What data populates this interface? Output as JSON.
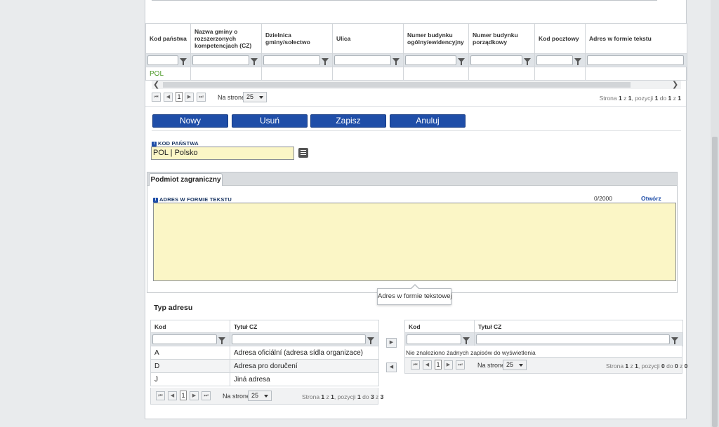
{
  "main_grid": {
    "columns": [
      "Kod państwa",
      "Nazwa gminy o rozszerzonych kompetencjach (CZ)",
      "Dzielnica gminy/sołectwo",
      "Ulica",
      "Numer budynku ogólny/ewidencyjny",
      "Numer budynku porządkowy",
      "Kod pocztowy",
      "Adres w formie tekstu"
    ],
    "rows": [
      [
        "POL",
        "",
        "",
        "",
        "",
        "",
        "",
        ""
      ]
    ],
    "pager": {
      "page": "1",
      "per_page_label": "Na stronę",
      "per_page": "25",
      "info": {
        "p1": "Strona",
        "page": "1",
        "p2": "z",
        "pages": "1",
        "p3": ", pozycji",
        "from": "1",
        "p4": "do",
        "to": "1",
        "p5": "z",
        "total": "1"
      }
    }
  },
  "actions": {
    "new": "Nowy",
    "delete": "Usuń",
    "save": "Zapisz",
    "cancel": "Anuluj"
  },
  "country_field": {
    "label": "KOD PAŃSTWA",
    "value": "POL | Polsko"
  },
  "tab": {
    "label": "Podmiot zagraniczny"
  },
  "address_text": {
    "label": "ADRES W FORMIE TEKSTU",
    "counter": "0/2000",
    "open_link": "Otwórz",
    "value": "",
    "tooltip": "Adres w formie tekstowej"
  },
  "address_type": {
    "title": "Typ adresu",
    "left_grid": {
      "columns": [
        "Kod",
        "Tytuł CZ"
      ],
      "rows": [
        [
          "A",
          "Adresa oficiální (adresa sídla organizace)"
        ],
        [
          "D",
          "Adresa pro doručení"
        ],
        [
          "J",
          "Jiná adresa"
        ]
      ],
      "pager": {
        "page": "1",
        "per_page_label": "Na stronę",
        "per_page": "25",
        "info": {
          "p1": "Strona",
          "page": "1",
          "p2": "z",
          "pages": "1",
          "p3": ", pozycji",
          "from": "1",
          "p4": "do",
          "to": "3",
          "p5": "z",
          "total": "3"
        }
      }
    },
    "right_grid": {
      "columns": [
        "Kod",
        "Tytuł CZ"
      ],
      "empty_message": "Nie znaleziono żadnych zapisów do wyświetlenia",
      "pager": {
        "page": "1",
        "per_page_label": "Na stronę",
        "per_page": "25",
        "info": {
          "p1": "Strona",
          "page": "1",
          "p2": "z",
          "pages": "1",
          "p3": ", pozycji",
          "from": "0",
          "p4": "do",
          "to": "0",
          "p5": "z",
          "total": "0"
        }
      }
    }
  },
  "colors": {
    "accent": "#1f4ea8",
    "input_highlight": "#fbf6c6",
    "link": "#1f4ea8",
    "country_code_text": "#4e9a2a"
  },
  "icons": {
    "filter": "funnel-icon",
    "first": "first-page-icon",
    "prev": "prev-page-icon",
    "next": "next-page-icon",
    "last": "last-page-icon",
    "list": "list-icon",
    "info": "info-icon",
    "move_right": "arrow-right-icon",
    "move_left": "arrow-left-icon"
  }
}
